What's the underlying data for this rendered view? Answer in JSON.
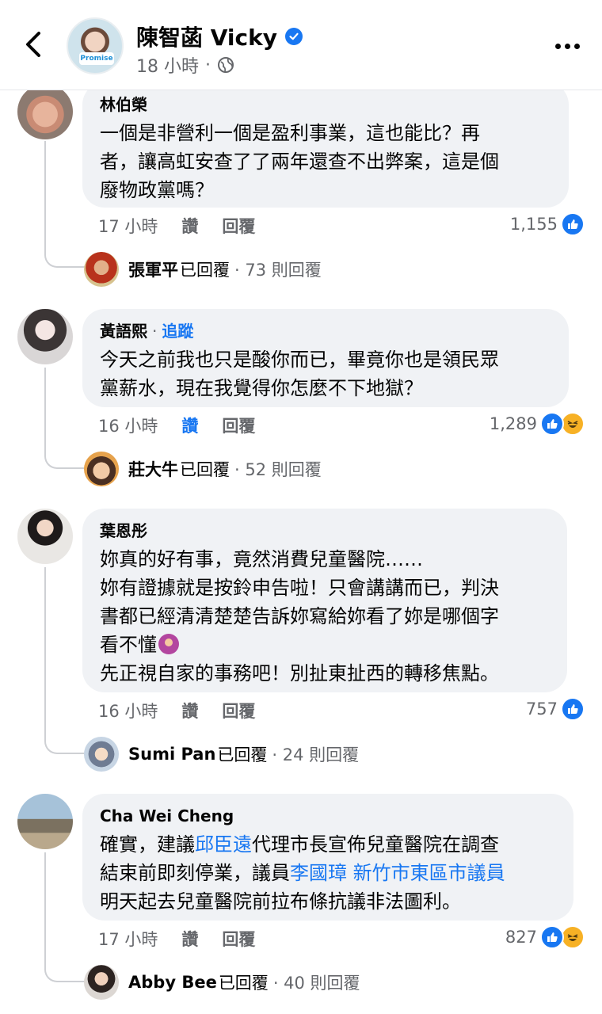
{
  "header": {
    "page_name": "陳智菡 Vicky",
    "time": "18 小時",
    "separator": "·",
    "avatar_badge": "Promise"
  },
  "comments": [
    {
      "author": "林伯榮",
      "follow": "",
      "lines": [
        "一個是非營利一個是盈利事業，這也能比？再",
        "者，讓高虹安查了了兩年還查不出弊案，這是個",
        "廢物政黨嗎？"
      ],
      "time": "17 小時",
      "like_label": "讚",
      "reply_label": "回覆",
      "liked": false,
      "reaction_count": "1,155",
      "reactions": [
        "like"
      ],
      "reply_summary": {
        "name": "張軍平",
        "did": "已回覆",
        "count": "· 73 則回覆"
      }
    },
    {
      "author": "黃語熙",
      "follow": "追蹤",
      "lines": [
        "今天之前我也只是酸你而已，畢竟你也是領民眾",
        "黨薪水，現在我覺得你怎麼不下地獄？"
      ],
      "time": "16 小時",
      "like_label": "讚",
      "reply_label": "回覆",
      "liked": true,
      "reaction_count": "1,289",
      "reactions": [
        "like",
        "haha"
      ],
      "reply_summary": {
        "name": "莊大牛",
        "did": "已回覆",
        "count": "· 52 則回覆"
      }
    },
    {
      "author": "葉恩彤",
      "follow": "",
      "lines": [
        "妳真的好有事，竟然消費兒童醫院……",
        "妳有證據就是按鈴申告啦！只會講講而已，判決",
        "書都已經清清楚楚告訴妳寫給妳看了妳是哪個字",
        "看不懂",
        "先正視自家的事務吧！別扯東扯西的轉移焦點。"
      ],
      "time": "16 小時",
      "like_label": "讚",
      "reply_label": "回覆",
      "liked": false,
      "reaction_count": "757",
      "reactions": [
        "like"
      ],
      "reply_summary": {
        "name": "Sumi Pan",
        "did": "已回覆",
        "count": "· 24 則回覆"
      }
    },
    {
      "author": "Cha Wei Cheng",
      "follow": "",
      "line1": {
        "pre": "確實，建議",
        "link": "邱臣遠",
        "post": "代理市長宣佈兒童醫院在調查"
      },
      "line2": "結束前即刻停業，議員",
      "line2_link": "李國璋 新竹市東區市議員",
      "line3": "明天起去兒童醫院前拉布條抗議非法圖利。",
      "time": "17 小時",
      "like_label": "讚",
      "reply_label": "回覆",
      "liked": false,
      "reaction_count": "827",
      "reactions": [
        "like",
        "haha"
      ],
      "reply_summary": {
        "name": "Abby Bee",
        "did": "已回覆",
        "count": "· 40 則回覆"
      }
    }
  ],
  "colors": {
    "accent": "#1877f2",
    "bubble": "#f0f2f5",
    "muted": "#65676b",
    "text": "#050505"
  },
  "icons": {
    "back": "chevron-left-icon",
    "verified": "verified-badge-icon",
    "audience": "globe-icon",
    "more": "more-horizontal-icon",
    "like": "like-reaction-icon",
    "haha": "haha-reaction-icon"
  }
}
